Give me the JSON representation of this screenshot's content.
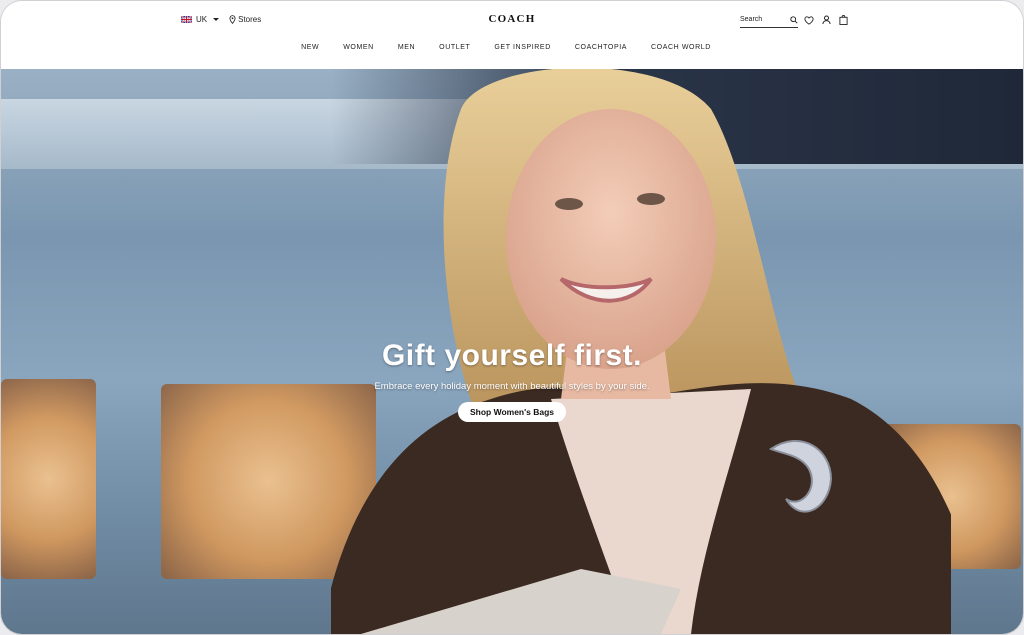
{
  "header": {
    "locale": "UK",
    "stores_label": "Stores",
    "logo": "COACH",
    "search_placeholder": "Search",
    "icons": [
      "search-icon",
      "heart-icon",
      "account-icon",
      "bag-icon"
    ]
  },
  "nav": {
    "items": [
      "NEW",
      "WOMEN",
      "MEN",
      "OUTLET",
      "GET INSPIRED",
      "COACHTOPIA",
      "COACH WORLD"
    ]
  },
  "hero": {
    "title": "Gift yourself first.",
    "subtitle": "Embrace every holiday moment with beautiful styles by your side.",
    "cta_label": "Shop Women's Bags"
  },
  "colors": {
    "text": "#222222",
    "cta_bg": "#ffffff",
    "hero_text": "#ffffff"
  }
}
